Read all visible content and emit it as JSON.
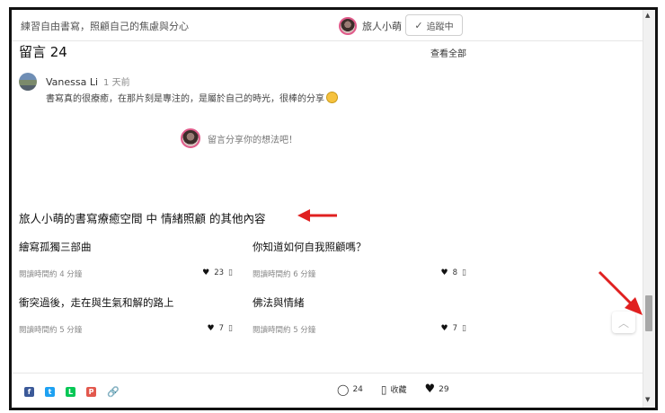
{
  "header": {
    "title": "練習自由書寫，照顧自己的焦慮與分心",
    "author_name": "旅人小萌",
    "follow_label": "追蹤中"
  },
  "comments": {
    "heading": "留言 24",
    "view_all": "查看全部",
    "items": [
      {
        "name": "Vanessa Li",
        "time": "1 天前",
        "text": "書寫真的很療癒，在那片刻是專注的，是屬於自己的時光，很棒的分享"
      }
    ],
    "reply_placeholder": "留言分享你的想法吧！"
  },
  "more": {
    "prefix": "旅人小萌的書寫療癒空間",
    "connector": "中",
    "category": "情緒照顧",
    "suffix": "的其他內容",
    "articles": [
      {
        "title": "繪寫孤獨三部曲",
        "read_time": "閱讀時間約 4 分鐘",
        "likes": "23"
      },
      {
        "title": "你知道如何自我照顧嗎？",
        "read_time": "閱讀時間約 6 分鐘",
        "likes": "8"
      },
      {
        "title": "衝突過後，走在與生氣和解的路上",
        "read_time": "閱讀時間約 5 分鐘",
        "likes": "7"
      },
      {
        "title": "佛法與情緒",
        "read_time": "閱讀時間約 5 分鐘",
        "likes": "7"
      }
    ]
  },
  "footer": {
    "comment_count": "24",
    "save_label": "收藏",
    "like_count": "29"
  },
  "colors": {
    "annotation_arrow": "#e02020",
    "avatar_ring": "#e05a8a"
  }
}
